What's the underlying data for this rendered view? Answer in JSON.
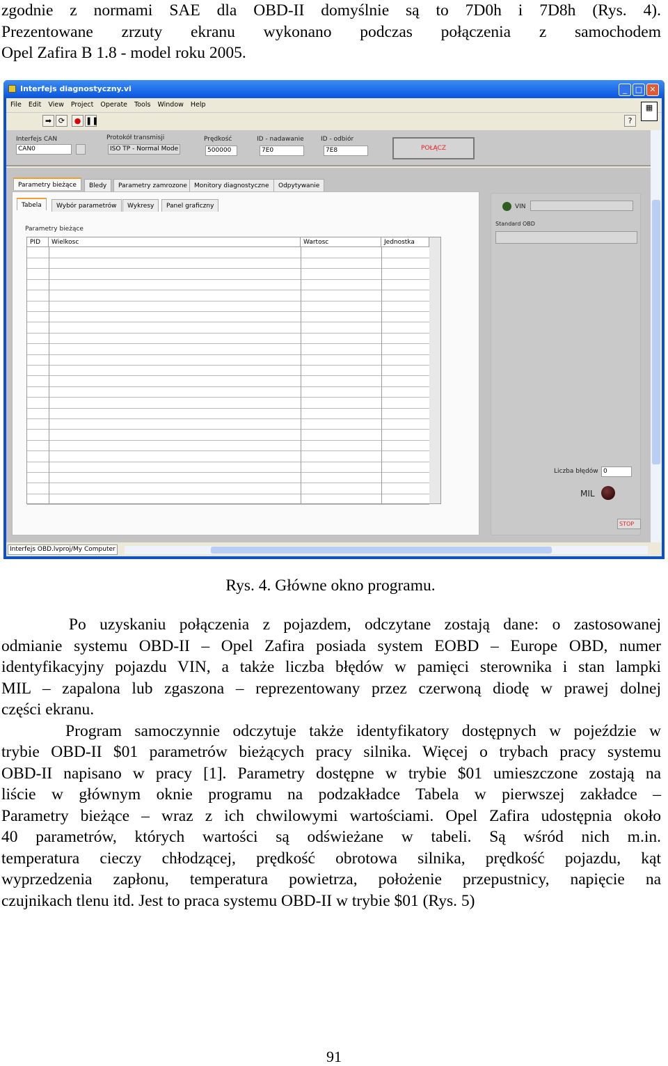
{
  "top_lines": [
    "zgodnie z normami SAE dla OBD-II domyślnie są to 7D0h i 7D8h (Rys. 4).",
    "Prezentowane zrzuty ekranu wykonano podczas połączenia z samochodem",
    "Opel Zafira B 1.8 - model roku 2005."
  ],
  "window": {
    "title": "Interfejs diagnostyczny.vi",
    "menu": [
      "File",
      "Edit",
      "View",
      "Project",
      "Operate",
      "Tools",
      "Window",
      "Help"
    ],
    "controls": {
      "can_label": "Interfejs CAN",
      "can_value": "CAN0",
      "protocol_label": "Protokół transmisji",
      "protocol_value": "ISO TP - Normal Mode",
      "speed_label": "Prędkość",
      "speed_value": "500000",
      "tx_label": "ID - nadawanie",
      "tx_value": "7E0",
      "rx_label": "ID - odbiór",
      "rx_value": "7E8",
      "connect_label": "POŁĄCZ"
    },
    "tabs": [
      "Parametry bieżące",
      "Bledy",
      "Parametry zamrozone",
      "Monitory diagnostyczne",
      "Odpytywanie"
    ],
    "subtabs": [
      "Tabela",
      "Wybór parametrów",
      "Wykresy",
      "Panel graficzny"
    ],
    "table_title": "Parametry bieżące",
    "columns": [
      "PID",
      "Wielkosc",
      "Wartosc",
      "Jednostka"
    ],
    "right": {
      "vin_label": "VIN",
      "vin_value": "",
      "std_label": "Standard OBD",
      "std_value": "",
      "errors_label": "Liczba błędów",
      "errors_value": "0",
      "mil_label": "MIL",
      "stop_label": "STOP"
    },
    "status": "Interfejs OBD.lvproj/My Computer"
  },
  "caption": "Rys. 4. Główne okno programu.",
  "paragraphs": [
    [
      "     Po uzyskaniu połączenia z pojazdem, odczytane zostają dane: o zastosowanej",
      "odmianie systemu OBD-II – Opel Zafira posiada system EOBD – Europe OBD, numer",
      "identyfikacyjny pojazdu VIN, a także liczba błędów w pamięci sterownika i stan lampki",
      "MIL – zapalona lub zgaszona – reprezentowany przez czerwoną diodę w prawej dolnej",
      "części ekranu."
    ],
    [
      "     Program samoczynnie odczytuje także identyfikatory dostępnych w pojeździe w",
      "trybie OBD-II $01 parametrów bieżących pracy silnika. Więcej o trybach pracy systemu",
      "OBD-II napisano w pracy [1]. Parametry dostępne w trybie $01 umieszczone zostają na",
      "liście w głównym oknie programu na podzakładce Tabela w pierwszej zakładce –",
      "Parametry bieżące – wraz z ich chwilowymi wartościami. Opel Zafira udostępnia około",
      "40 parametrów, których wartości są odświeżane w tabeli. Są wśród nich m.in.",
      "temperatura cieczy chłodzącej, prędkość obrotowa silnika, prędkość pojazdu, kąt",
      "wyprzedzenia zapłonu, temperatura powietrza, położenie przepustnicy, napięcie na",
      "czujnikach tlenu itd. Jest to praca systemu OBD-II w trybie $01 (Rys. 5)"
    ]
  ],
  "page_number": "91"
}
